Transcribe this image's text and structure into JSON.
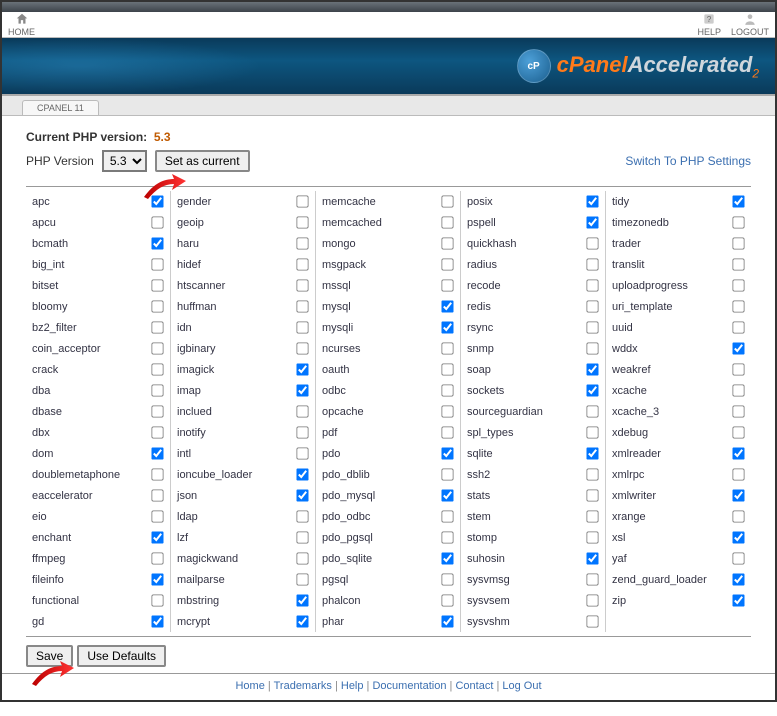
{
  "topbar": {
    "home": "HOME",
    "help": "HELP",
    "logout": "LOGOUT"
  },
  "banner": {
    "cp": "cPanel",
    "acc": "Accelerated",
    "two": "2"
  },
  "tab": "CPANEL 11",
  "current_label": "Current PHP version:",
  "current_value": "5.3",
  "phpver_label": "PHP Version",
  "select_value": "5.3",
  "set_current": "Set as current",
  "switch_link": "Switch To PHP Settings",
  "save": "Save",
  "use_defaults": "Use Defaults",
  "footer": [
    "Home",
    "Trademarks",
    "Help",
    "Documentation",
    "Contact",
    "Log Out"
  ],
  "extensions": [
    [
      {
        "n": "apc",
        "c": true
      },
      {
        "n": "apcu",
        "c": false
      },
      {
        "n": "bcmath",
        "c": true
      },
      {
        "n": "big_int",
        "c": false
      },
      {
        "n": "bitset",
        "c": false
      },
      {
        "n": "bloomy",
        "c": false
      },
      {
        "n": "bz2_filter",
        "c": false
      },
      {
        "n": "coin_acceptor",
        "c": false
      },
      {
        "n": "crack",
        "c": false
      },
      {
        "n": "dba",
        "c": false
      },
      {
        "n": "dbase",
        "c": false
      },
      {
        "n": "dbx",
        "c": false
      },
      {
        "n": "dom",
        "c": true
      },
      {
        "n": "doublemetaphone",
        "c": false
      },
      {
        "n": "eaccelerator",
        "c": false
      },
      {
        "n": "eio",
        "c": false
      },
      {
        "n": "enchant",
        "c": true
      },
      {
        "n": "ffmpeg",
        "c": false
      },
      {
        "n": "fileinfo",
        "c": true
      },
      {
        "n": "functional",
        "c": false
      },
      {
        "n": "gd",
        "c": true
      }
    ],
    [
      {
        "n": "gender",
        "c": false
      },
      {
        "n": "geoip",
        "c": false
      },
      {
        "n": "haru",
        "c": false
      },
      {
        "n": "hidef",
        "c": false
      },
      {
        "n": "htscanner",
        "c": false
      },
      {
        "n": "huffman",
        "c": false
      },
      {
        "n": "idn",
        "c": false
      },
      {
        "n": "igbinary",
        "c": false
      },
      {
        "n": "imagick",
        "c": true
      },
      {
        "n": "imap",
        "c": true
      },
      {
        "n": "inclued",
        "c": false
      },
      {
        "n": "inotify",
        "c": false
      },
      {
        "n": "intl",
        "c": false
      },
      {
        "n": "ioncube_loader",
        "c": true
      },
      {
        "n": "json",
        "c": true
      },
      {
        "n": "ldap",
        "c": false
      },
      {
        "n": "lzf",
        "c": false
      },
      {
        "n": "magickwand",
        "c": false
      },
      {
        "n": "mailparse",
        "c": false
      },
      {
        "n": "mbstring",
        "c": true
      },
      {
        "n": "mcrypt",
        "c": true
      }
    ],
    [
      {
        "n": "memcache",
        "c": false
      },
      {
        "n": "memcached",
        "c": false
      },
      {
        "n": "mongo",
        "c": false
      },
      {
        "n": "msgpack",
        "c": false
      },
      {
        "n": "mssql",
        "c": false
      },
      {
        "n": "mysql",
        "c": true
      },
      {
        "n": "mysqli",
        "c": true
      },
      {
        "n": "ncurses",
        "c": false
      },
      {
        "n": "oauth",
        "c": false
      },
      {
        "n": "odbc",
        "c": false
      },
      {
        "n": "opcache",
        "c": false
      },
      {
        "n": "pdf",
        "c": false
      },
      {
        "n": "pdo",
        "c": true
      },
      {
        "n": "pdo_dblib",
        "c": false
      },
      {
        "n": "pdo_mysql",
        "c": true
      },
      {
        "n": "pdo_odbc",
        "c": false
      },
      {
        "n": "pdo_pgsql",
        "c": false
      },
      {
        "n": "pdo_sqlite",
        "c": true
      },
      {
        "n": "pgsql",
        "c": false
      },
      {
        "n": "phalcon",
        "c": false
      },
      {
        "n": "phar",
        "c": true
      }
    ],
    [
      {
        "n": "posix",
        "c": true
      },
      {
        "n": "pspell",
        "c": true
      },
      {
        "n": "quickhash",
        "c": false
      },
      {
        "n": "radius",
        "c": false
      },
      {
        "n": "recode",
        "c": false
      },
      {
        "n": "redis",
        "c": false
      },
      {
        "n": "rsync",
        "c": false
      },
      {
        "n": "snmp",
        "c": false
      },
      {
        "n": "soap",
        "c": true
      },
      {
        "n": "sockets",
        "c": true
      },
      {
        "n": "sourceguardian",
        "c": false
      },
      {
        "n": "spl_types",
        "c": false
      },
      {
        "n": "sqlite",
        "c": true
      },
      {
        "n": "ssh2",
        "c": false
      },
      {
        "n": "stats",
        "c": false
      },
      {
        "n": "stem",
        "c": false
      },
      {
        "n": "stomp",
        "c": false
      },
      {
        "n": "suhosin",
        "c": true
      },
      {
        "n": "sysvmsg",
        "c": false
      },
      {
        "n": "sysvsem",
        "c": false
      },
      {
        "n": "sysvshm",
        "c": false
      }
    ],
    [
      {
        "n": "tidy",
        "c": true
      },
      {
        "n": "timezonedb",
        "c": false
      },
      {
        "n": "trader",
        "c": false
      },
      {
        "n": "translit",
        "c": false
      },
      {
        "n": "uploadprogress",
        "c": false
      },
      {
        "n": "uri_template",
        "c": false
      },
      {
        "n": "uuid",
        "c": false
      },
      {
        "n": "wddx",
        "c": true
      },
      {
        "n": "weakref",
        "c": false
      },
      {
        "n": "xcache",
        "c": false
      },
      {
        "n": "xcache_3",
        "c": false
      },
      {
        "n": "xdebug",
        "c": false
      },
      {
        "n": "xmlreader",
        "c": true
      },
      {
        "n": "xmlrpc",
        "c": false
      },
      {
        "n": "xmlwriter",
        "c": true
      },
      {
        "n": "xrange",
        "c": false
      },
      {
        "n": "xsl",
        "c": true
      },
      {
        "n": "yaf",
        "c": false
      },
      {
        "n": "zend_guard_loader",
        "c": true
      },
      {
        "n": "zip",
        "c": true
      }
    ]
  ]
}
